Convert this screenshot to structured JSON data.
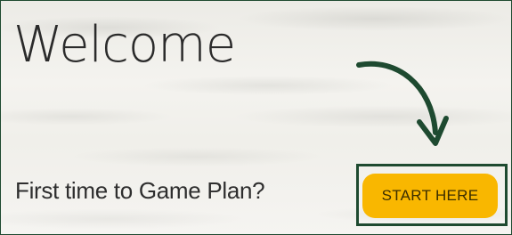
{
  "hero": {
    "title": "Welcome"
  },
  "prompt": {
    "text": "First time to Game Plan?"
  },
  "cta": {
    "label": "START HERE"
  },
  "colors": {
    "button_bg": "#f9b700",
    "annotation": "#1e4a30",
    "text": "#2b2b2b"
  },
  "icons": {
    "annotation_arrow": "curved-arrow-down-icon"
  }
}
